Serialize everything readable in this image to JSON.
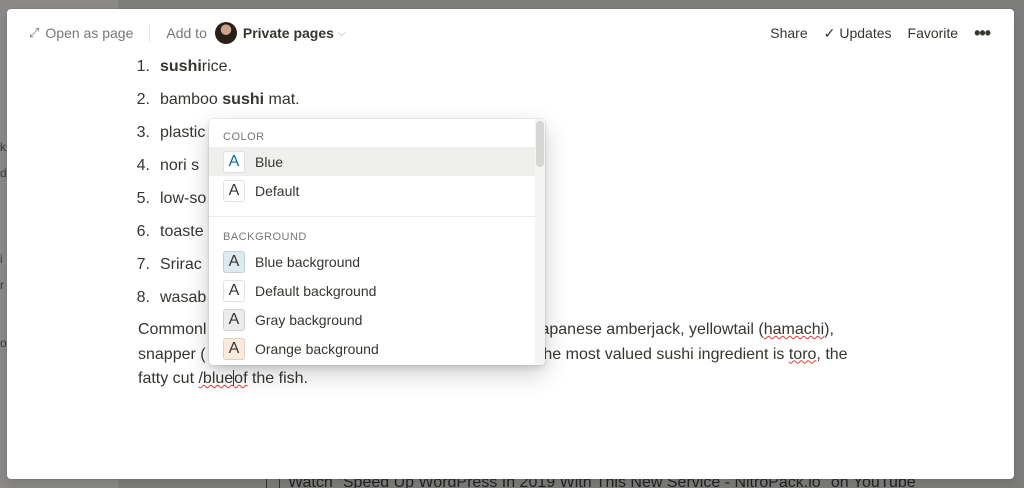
{
  "topbar": {
    "open_as_page": "Open as page",
    "add_to": "Add to",
    "private_pages": "Private pages",
    "share": "Share",
    "updates": "Updates",
    "favorite": "Favorite",
    "more": "•••"
  },
  "list": [
    {
      "num": "1.",
      "pre": "",
      "bold": "sushi",
      "post": " rice."
    },
    {
      "num": "2.",
      "pre": "bamboo ",
      "bold": "sushi",
      "post": " mat."
    },
    {
      "num": "3.",
      "pre": "plastic",
      "bold": "",
      "post": ""
    },
    {
      "num": "4.",
      "pre": "nori s",
      "bold": "",
      "post": ""
    },
    {
      "num": "5.",
      "pre": "low-so",
      "bold": "",
      "post": ""
    },
    {
      "num": "6.",
      "pre": "toaste",
      "bold": "",
      "post": ""
    },
    {
      "num": "7.",
      "pre": "Srirac",
      "bold": "",
      "post": ""
    },
    {
      "num": "8.",
      "pre": "wasab",
      "bold": "",
      "post": ""
    }
  ],
  "paragraph": {
    "line1_a": "Commonl",
    "line1_b": "apanese amberjack, yellowtail (",
    "line1_hamachi": "hamachi",
    "line1_c": "),",
    "line2_a": "snapper (",
    "line2_b": "The most valued sushi ingredient is ",
    "line2_toro": "toro",
    "line2_c": ", the",
    "line3_a": "fatty cut ",
    "line3_cmd": "/blue",
    "line3_b": "of",
    "line3_c": " the fish."
  },
  "menu": {
    "color_header": "COLOR",
    "background_header": "BACKGROUND",
    "color_items": [
      {
        "label": "Blue",
        "letter": "A",
        "fg": "#0b6e99",
        "bg": "#ffffff"
      },
      {
        "label": "Default",
        "letter": "A",
        "fg": "#37352f",
        "bg": "#ffffff"
      }
    ],
    "background_items": [
      {
        "label": "Blue background",
        "letter": "A",
        "fg": "#37352f",
        "bg": "#ddebf1"
      },
      {
        "label": "Default background",
        "letter": "A",
        "fg": "#37352f",
        "bg": "#ffffff"
      },
      {
        "label": "Gray background",
        "letter": "A",
        "fg": "#37352f",
        "bg": "#ebeced"
      },
      {
        "label": "Orange background",
        "letter": "A",
        "fg": "#37352f",
        "bg": "#faebdd"
      }
    ]
  },
  "background_page": {
    "bottom_link": "Watch \"Speed Up WordPress In 2019 With This New Service - NitroPack.io\" on YouTube"
  }
}
